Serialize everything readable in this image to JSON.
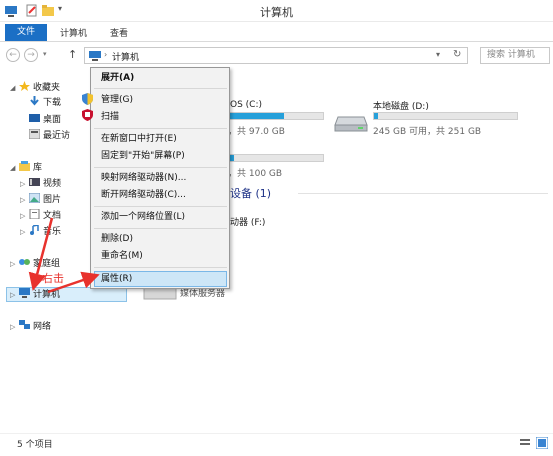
{
  "window": {
    "title": "计算机"
  },
  "ribbon": {
    "tabs": [
      "文件",
      "计算机",
      "查看"
    ]
  },
  "address": {
    "path": "计算机"
  },
  "search": {
    "placeholder": "搜索 计算机"
  },
  "nav": {
    "favorites": "收藏夹",
    "downloads": "下载",
    "desktop": "桌面",
    "recent": "最近访",
    "library": "库",
    "videos": "视频",
    "pictures": "图片",
    "documents": "文档",
    "music": "音乐",
    "homegroup": "家庭组",
    "computer": "计算机",
    "network": "网络"
  },
  "content": {
    "drive_c_name": "OS (C:)",
    "drive_c_free": "，共 97.0 GB",
    "drive_c_fraction": 0.58,
    "drive_d_name": "本地磁盘 (D:)",
    "drive_d_free": "245 GB 可用，共 251 GB",
    "drive_d_fraction": 0.03,
    "drive_e_free": "，共 100 GB",
    "drive_e_fraction": 0.05,
    "devices_header": "设备 (1)",
    "drive_f": "动器 (F:)",
    "media_server": "媒体服务器"
  },
  "context_menu": {
    "items": [
      "展开(A)",
      "管理(G)",
      "扫描",
      "在新窗口中打开(E)",
      "固定到\"开始\"屏幕(P)",
      "映射网络驱动器(N)...",
      "断开网络驱动器(C)...",
      "添加一个网络位置(L)",
      "删除(D)",
      "重命名(M)",
      "属性(R)"
    ]
  },
  "annotation": {
    "text": "右击"
  },
  "status": {
    "count": "5 个项目"
  },
  "colors": {
    "accent": "#1b6fc5",
    "annotation": "#e8322d",
    "selection": "#cde6f7"
  }
}
